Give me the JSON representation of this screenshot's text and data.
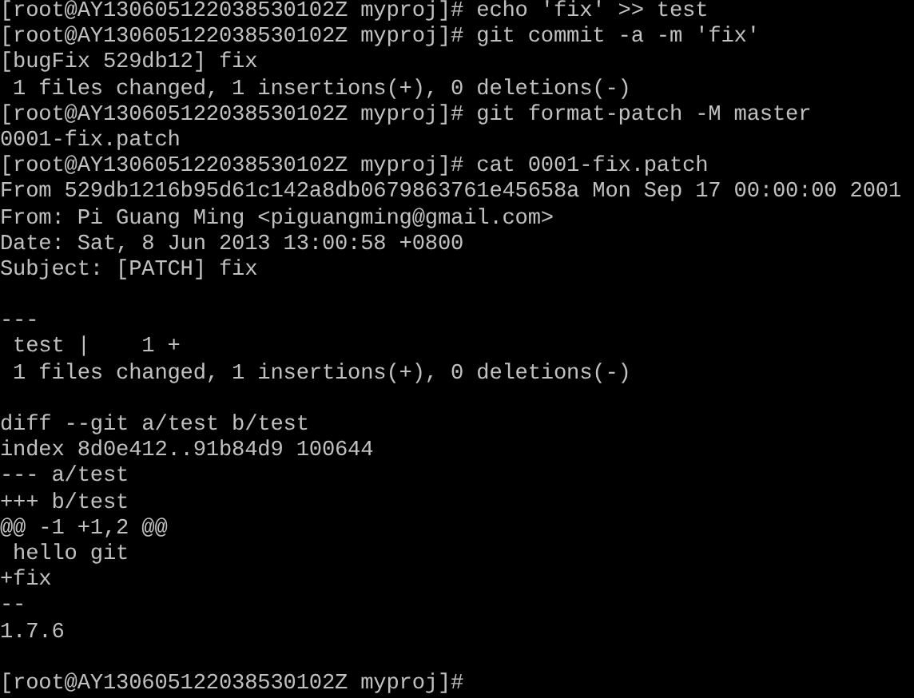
{
  "terminal": {
    "lines": [
      {
        "kind": "text",
        "text": "[root@AY130605122038530102Z myproj]# echo 'fix' >> test"
      },
      {
        "kind": "text",
        "text": "[root@AY130605122038530102Z myproj]# git commit -a -m 'fix'"
      },
      {
        "kind": "text",
        "text": "[bugFix 529db12] fix"
      },
      {
        "kind": "text",
        "text": " 1 files changed, 1 insertions(+), 0 deletions(-)"
      },
      {
        "kind": "text",
        "text": "[root@AY130605122038530102Z myproj]# git format-patch -M master"
      },
      {
        "kind": "text",
        "text": "0001-fix.patch"
      },
      {
        "kind": "text",
        "text": "[root@AY130605122038530102Z myproj]# cat 0001-fix.patch"
      },
      {
        "kind": "text",
        "text": "From 529db1216b95d61c142a8db0679863761e45658a Mon Sep 17 00:00:00 2001"
      },
      {
        "kind": "text",
        "text": "From: Pi Guang Ming <piguangming@gmail.com>"
      },
      {
        "kind": "text",
        "text": "Date: Sat, 8 Jun 2013 13:00:58 +0800"
      },
      {
        "kind": "text",
        "text": "Subject: [PATCH] fix"
      },
      {
        "kind": "blank"
      },
      {
        "kind": "text",
        "text": "---"
      },
      {
        "kind": "text",
        "text": " test |    1 +"
      },
      {
        "kind": "text",
        "text": " 1 files changed, 1 insertions(+), 0 deletions(-)"
      },
      {
        "kind": "blank"
      },
      {
        "kind": "text",
        "text": "diff --git a/test b/test"
      },
      {
        "kind": "text",
        "text": "index 8d0e412..91b84d9 100644"
      },
      {
        "kind": "text",
        "text": "--- a/test"
      },
      {
        "kind": "text",
        "text": "+++ b/test"
      },
      {
        "kind": "text",
        "text": "@@ -1 +1,2 @@"
      },
      {
        "kind": "text",
        "text": " hello git"
      },
      {
        "kind": "text",
        "text": "+fix"
      },
      {
        "kind": "text",
        "text": "--"
      },
      {
        "kind": "text",
        "text": "1.7.6"
      },
      {
        "kind": "blank"
      },
      {
        "kind": "text",
        "text": "[root@AY130605122038530102Z myproj]#"
      }
    ]
  }
}
